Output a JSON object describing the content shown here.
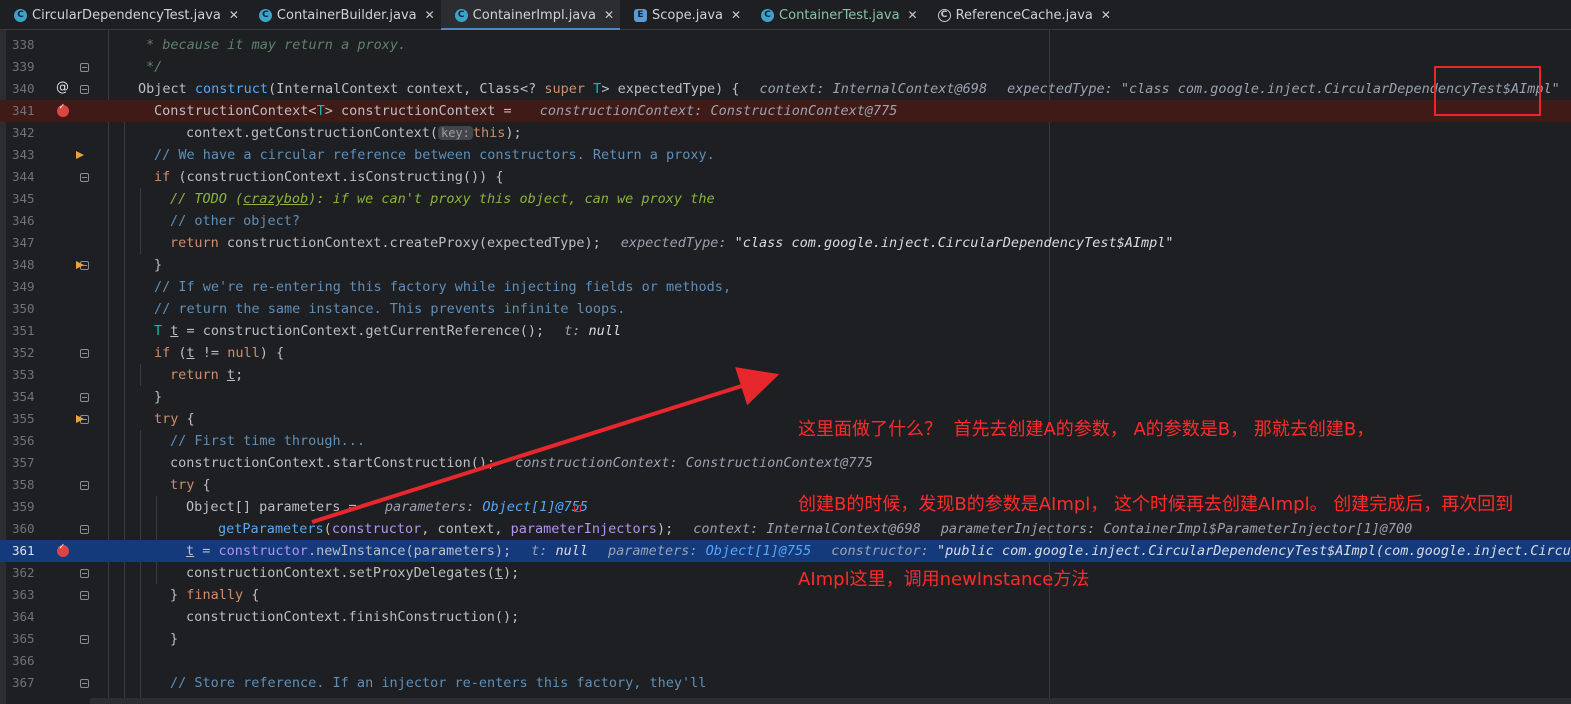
{
  "tabs": [
    {
      "label": "CircularDependencyTest.java",
      "icon": "class-icon",
      "glyph": "C",
      "active": false,
      "green": false
    },
    {
      "label": "ContainerBuilder.java",
      "icon": "class-icon",
      "glyph": "C",
      "active": false,
      "green": false
    },
    {
      "label": "ContainerImpl.java",
      "icon": "class-icon",
      "glyph": "C",
      "active": true,
      "green": false
    },
    {
      "label": "Scope.java",
      "icon": "enum-icon",
      "glyph": "E",
      "active": false,
      "green": false
    },
    {
      "label": "ContainerTest.java",
      "icon": "class-icon",
      "glyph": "C",
      "active": false,
      "green": true
    },
    {
      "label": "ReferenceCache.java",
      "icon": "abstract-class-icon",
      "glyph": "C",
      "active": false,
      "green": false
    }
  ],
  "tab_close_glyph": "✕",
  "gutter_at_glyph": "@",
  "lines": [
    {
      "n": "338"
    },
    {
      "n": "339"
    },
    {
      "n": "340"
    },
    {
      "n": "341"
    },
    {
      "n": "342"
    },
    {
      "n": "343"
    },
    {
      "n": "344"
    },
    {
      "n": "345"
    },
    {
      "n": "346"
    },
    {
      "n": "347"
    },
    {
      "n": "348"
    },
    {
      "n": "349"
    },
    {
      "n": "350"
    },
    {
      "n": "351"
    },
    {
      "n": "352"
    },
    {
      "n": "353"
    },
    {
      "n": "354"
    },
    {
      "n": "355"
    },
    {
      "n": "356"
    },
    {
      "n": "357"
    },
    {
      "n": "358"
    },
    {
      "n": "359"
    },
    {
      "n": "360"
    },
    {
      "n": "361"
    },
    {
      "n": "362"
    },
    {
      "n": "363"
    },
    {
      "n": "364"
    },
    {
      "n": "365"
    },
    {
      "n": "366"
    },
    {
      "n": "367"
    }
  ],
  "code": {
    "l338": "* because it may return a proxy.",
    "l339": "*/",
    "l340_type": "Object ",
    "l340_name": "construct",
    "l340_sig_a": "(InternalContext context, Class<? ",
    "l340_super": "super",
    "l340_T": " T",
    "l340_sig_b": "> expectedType) {",
    "l340_h1k": "context: ",
    "l340_h1v": "InternalContext@698",
    "l340_h2k": "expectedType: ",
    "l340_h2v": "\"class com.google.inject.CircularDependencyTest$AImpl\"",
    "l341_a": "ConstructionContext<",
    "l341_T": "T",
    "l341_b": "> constructionContext = ",
    "l341_hk": "constructionContext: ",
    "l341_hv": "ConstructionContext@775",
    "l342_a": "context.getConstructionContext(",
    "l342_pill": "key:",
    "l342_this": "this",
    "l342_b": ");",
    "l343": "// We have a circular reference between constructors. Return a proxy.",
    "l344_if": "if",
    "l344_b": " (constructionContext.isConstructing()) {",
    "l345_a": "// TODO (",
    "l345_u": "crazybob",
    "l345_b": "): if we can't proxy this object, can we proxy the",
    "l346": "// other object?",
    "l347_ret": "return",
    "l347_b": " constructionContext.createProxy(expectedType);",
    "l347_hk": "expectedType: ",
    "l347_hv": "\"class com.google.inject.CircularDependencyTest$AImpl\"",
    "l348": "}",
    "l349": "// If we're re-entering this factory while injecting fields or methods,",
    "l350": "// return the same instance. This prevents infinite loops.",
    "l351_T": "T ",
    "l351_t": "t",
    "l351_b": " = constructionContext.getCurrentReference();",
    "l351_hk": "t: ",
    "l351_hv": "null",
    "l352_if": "if",
    "l352_a": " (",
    "l352_t": "t",
    "l352_b": " != ",
    "l352_null": "null",
    "l352_c": ") {",
    "l353_ret": "return",
    "l353_sp": " ",
    "l353_t": "t",
    "l353_b": ";",
    "l354": "}",
    "l355_try": "try",
    "l355_b": " {",
    "l356": "// First time through...",
    "l357": "constructionContext.startConstruction();",
    "l357_hk": "constructionContext: ",
    "l357_hv": "ConstructionContext@775",
    "l358_try": "try",
    "l358_b": " {",
    "l359": "Object[] parameters = ",
    "l359_hk": "parameters: ",
    "l359_hv": "Object[1]@755",
    "l360_fn": "getParameters",
    "l360_a": "(",
    "l360_p1": "constructor",
    "l360_b": ", context, ",
    "l360_p2": "parameterInjectors",
    "l360_c": ");",
    "l360_h1k": "context: ",
    "l360_h1v": "InternalContext@698",
    "l360_h2k": "parameterInjectors: ",
    "l360_h2v": "ContainerImpl$ParameterInjector[1]@700",
    "l361_t": "t",
    "l361_a": " = ",
    "l361_ctor": "constructor",
    "l361_b": ".newInstance(parameters);",
    "l361_h1k": "t: ",
    "l361_h1v": "null",
    "l361_h2k": "parameters: ",
    "l361_h2v": "Object[1]@755",
    "l361_h3k": "constructor: ",
    "l361_h3v": "\"public com.google.inject.CircularDependencyTest$AImpl(com.google.inject.Circula",
    "l362_a": "constructionContext.setProxyDelegates(",
    "l362_t": "t",
    "l362_b": ");",
    "l363_a": "} ",
    "l363_fin": "finally",
    "l363_b": " {",
    "l364": "constructionContext.finishConstruction();",
    "l365": "}",
    "l367": "// Store reference. If an injector re-enters this factory, they'll"
  },
  "annotation": {
    "line1": "这里面做了什么？  首先去创建A的参数， A的参数是B， 那就去创建B，",
    "line2": "创建B的时候，发现B的参数是AImpl， 这个时候再去创建AImpl。 创建完成后，再次回到",
    "line3": "AImpl这里，调用newInstance方法"
  },
  "colors": {
    "background": "#1e1f22",
    "breakpoint_line": "#3f1a16",
    "current_line": "#143a7c",
    "annotation_red": "#ff2a2a",
    "keyword": "#cf8e6d",
    "function": "#56a8f5"
  }
}
